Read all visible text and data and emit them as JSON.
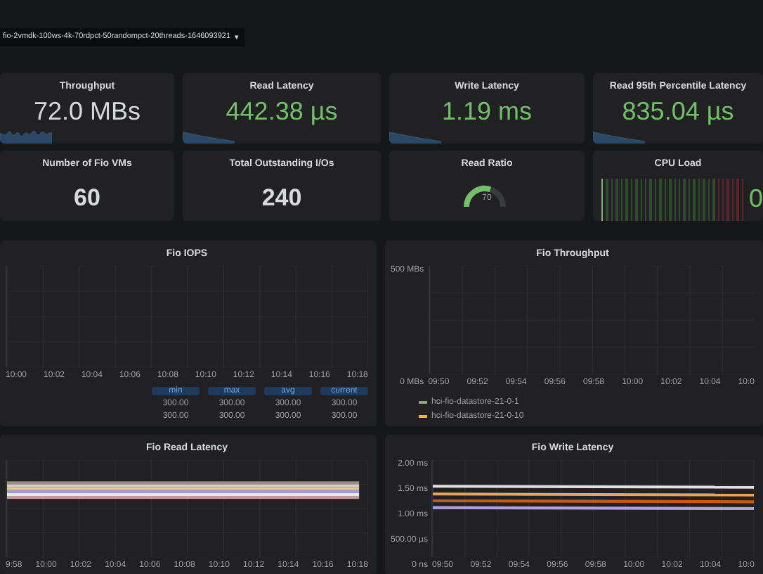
{
  "dashboard_picker": {
    "label": "fio-2vmdk-100ws-4k-70rdpct-50randompct-20threads-1646093921",
    "caret": "▾"
  },
  "stat_row": [
    {
      "kind": "stat",
      "title": "Throughput",
      "value": "72.0 MBs",
      "color": "#d8d9da"
    },
    {
      "kind": "stat",
      "title": "Read Latency",
      "value": "442.38 µs",
      "color": "#73bf69"
    },
    {
      "kind": "stat",
      "title": "Write Latency",
      "value": "1.19 ms",
      "color": "#73bf69"
    },
    {
      "kind": "stat",
      "title": "Read 95th Percentile Latency",
      "value": "835.04 µs",
      "color": "#73bf69"
    }
  ],
  "info_row": [
    {
      "kind": "number",
      "title": "Number of Fio VMs",
      "value": "60"
    },
    {
      "kind": "number",
      "title": "Total Outstanding I/Os",
      "value": "240"
    },
    {
      "kind": "gauge",
      "title": "Read Ratio",
      "value": "70",
      "level": 0.7
    },
    {
      "kind": "bargauge",
      "title": "CPU Load",
      "value": "0",
      "level": 0.03
    }
  ],
  "graphs": [
    {
      "kind": "table_legend",
      "title": "Fio IOPS",
      "xticks": [
        "10:00",
        "10:02",
        "10:04",
        "10:06",
        "10:08",
        "10:10",
        "10:12",
        "10:14",
        "10:16",
        "10:18"
      ],
      "legend_columns": [
        "min",
        "max",
        "avg",
        "current"
      ],
      "legend_rows": [
        [
          "300.00",
          "300.00",
          "300.00",
          "300.00"
        ],
        [
          "300.00",
          "300.00",
          "300.00",
          "300.00"
        ]
      ]
    },
    {
      "kind": "list_legend",
      "title": "Fio Throughput",
      "yticks": [
        "500 MBs",
        "0 MBs"
      ],
      "xticks": [
        "09:50",
        "09:52",
        "09:54",
        "09:56",
        "09:58",
        "10:00",
        "10:02",
        "10:04",
        "10:0"
      ],
      "legend_items": [
        {
          "label": "hci-fio-datastore-21-0-1",
          "color": "#7eb26d"
        },
        {
          "label": "hci-fio-datastore-21-0-10",
          "color": "#eab839"
        }
      ]
    },
    {
      "kind": "band",
      "title": "Fio Read Latency",
      "xticks": [
        "9:58",
        "10:00",
        "10:02",
        "10:04",
        "10:06",
        "10:08",
        "10:10",
        "10:12",
        "10:14",
        "10:16",
        "10:18"
      ]
    },
    {
      "kind": "lines",
      "title": "Fio Write Latency",
      "yticks": [
        "2.00 ms",
        "1.50 ms",
        "1.00 ms",
        "500.00 µs",
        "0 ns"
      ],
      "xticks": [
        "09:50",
        "09:52",
        "09:54",
        "09:56",
        "09:58",
        "10:00",
        "10:02",
        "10:04",
        "10:0"
      ]
    }
  ]
}
